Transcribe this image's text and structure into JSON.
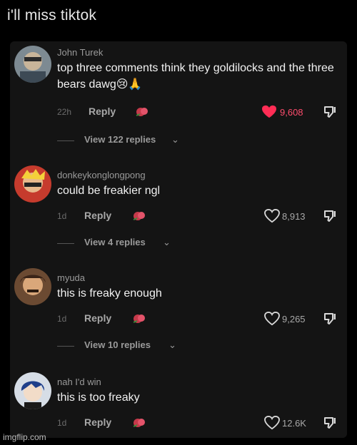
{
  "caption": "i'll miss tiktok",
  "watermark": "imgflip.com",
  "colors": {
    "background": "#000000",
    "panel": "#141414",
    "liked_heart": "#ff2d55",
    "text": "#f2f2f2",
    "muted": "#9a9a9a"
  },
  "comments": [
    {
      "username": "John Turek",
      "text": "top three comments think they goldilocks and the three bears dawg😢🙏",
      "time": "22h",
      "reply_label": "Reply",
      "likes": "9,608",
      "liked": true,
      "view_replies": "View 122 replies",
      "icons": [
        "avatar",
        "rose-icon",
        "heart-icon",
        "dislike-icon",
        "chevron-down-icon"
      ]
    },
    {
      "username": "donkeykonglongpong",
      "text": "could be freakier ngl",
      "time": "1d",
      "reply_label": "Reply",
      "likes": "8,913",
      "liked": false,
      "view_replies": "View 4 replies"
    },
    {
      "username": "myuda",
      "text": "this is freaky enough",
      "time": "1d",
      "reply_label": "Reply",
      "likes": "9,265",
      "liked": false,
      "view_replies": "View 10 replies"
    },
    {
      "username": "nah I'd win",
      "text": "this is too freaky",
      "time": "1d",
      "reply_label": "Reply",
      "likes": "12.6K",
      "liked": false
    }
  ]
}
